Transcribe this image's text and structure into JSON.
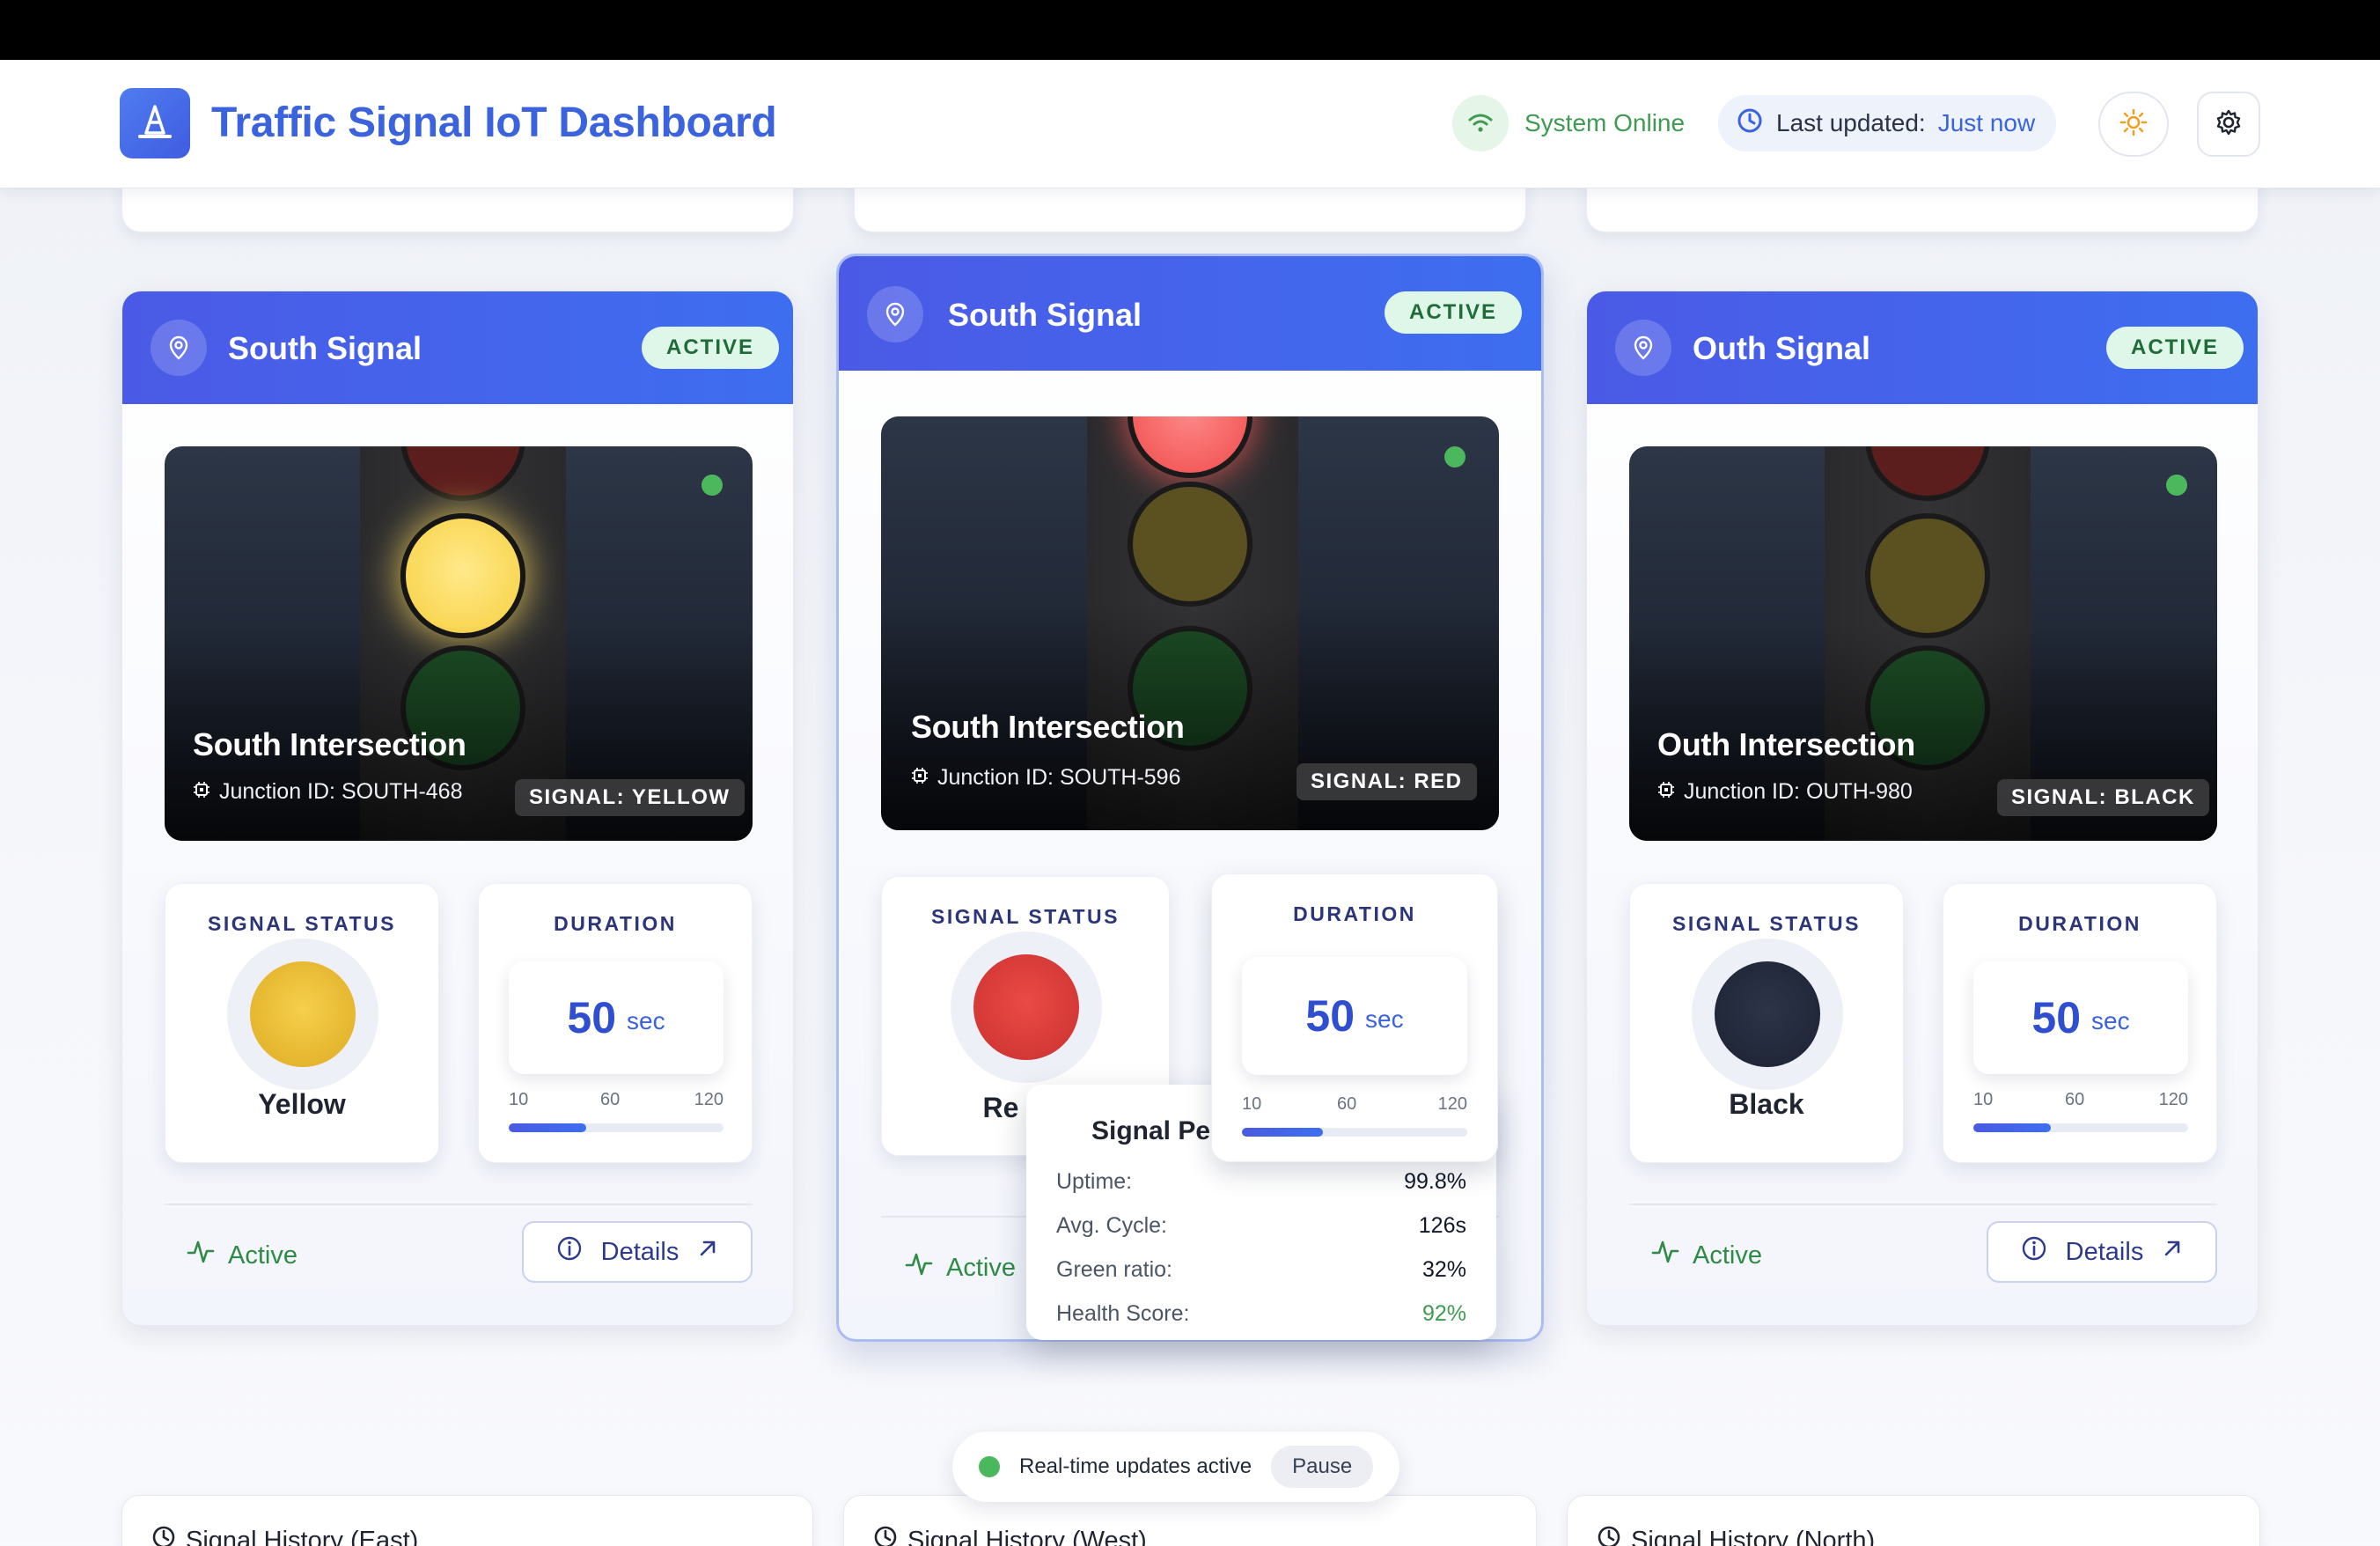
{
  "header": {
    "title": "Traffic Signal IoT Dashboard",
    "system_status": "System Online",
    "last_updated_label": "Last updated:",
    "last_updated_value": "Just now"
  },
  "cards": [
    {
      "title": "South Signal",
      "badge": "ACTIVE",
      "intersection": "South Intersection",
      "junction": "Junction ID: SOUTH-468",
      "signal_tag": "SIGNAL: YELLOW",
      "status_label": "SIGNAL STATUS",
      "status_value": "Yellow",
      "duration_label": "DURATION",
      "duration_value": "50",
      "duration_unit": "sec",
      "ticks": [
        "10",
        "60",
        "120"
      ],
      "duration_fraction": 0.36,
      "footer_status": "Active",
      "details_label": "Details"
    },
    {
      "title": "South Signal",
      "badge": "ACTIVE",
      "intersection": "South Intersection",
      "junction": "Junction ID: SOUTH-596",
      "signal_tag": "SIGNAL: RED",
      "status_label": "SIGNAL STATUS",
      "status_value": "Re",
      "duration_label": "DURATION",
      "duration_value": "50",
      "duration_unit": "sec",
      "ticks": [
        "10",
        "60",
        "120"
      ],
      "duration_fraction": 0.36,
      "footer_status": "Active"
    },
    {
      "title": "Outh Signal",
      "badge": "ACTIVE",
      "intersection": "Outh Intersection",
      "junction": "Junction ID: OUTH-980",
      "signal_tag": "SIGNAL: BLACK",
      "status_label": "SIGNAL STATUS",
      "status_value": "Black",
      "duration_label": "DURATION",
      "duration_value": "50",
      "duration_unit": "sec",
      "ticks": [
        "10",
        "60",
        "120"
      ],
      "duration_fraction": 0.36,
      "footer_status": "Active",
      "details_label": "Details"
    }
  ],
  "tooltip": {
    "title": "Signal Per",
    "rows": [
      {
        "label": "Uptime:",
        "value": "99.8%"
      },
      {
        "label": "Avg. Cycle:",
        "value": "126s"
      },
      {
        "label": "Green ratio:",
        "value": "32%"
      },
      {
        "label": "Health Score:",
        "value": "92%"
      }
    ]
  },
  "realtime": {
    "label": "Real-time updates active",
    "pause_label": "Pause"
  },
  "history": [
    {
      "title": "Signal History (East)"
    },
    {
      "title": "Signal History (West)"
    },
    {
      "title": "Signal History (North)"
    }
  ],
  "colors": {
    "accent": "#3b63dd",
    "header_gradient_start": "#4b5ae6",
    "header_gradient_end": "#3e6ef0",
    "online_green": "#3f9a52",
    "yellow_signal": "#f7cf3f",
    "red_signal": "#ef4b4b"
  },
  "icons": {
    "logo": "traffic-cone-icon",
    "online": "wifi-icon",
    "updated": "clock-icon",
    "theme": "sun-icon",
    "settings": "gear-icon",
    "card_location": "map-pin-icon",
    "junction": "chip-icon",
    "footer_activity": "activity-icon",
    "details_info": "info-icon",
    "details_arrow": "arrow-up-right-icon",
    "history": "clock-icon"
  }
}
